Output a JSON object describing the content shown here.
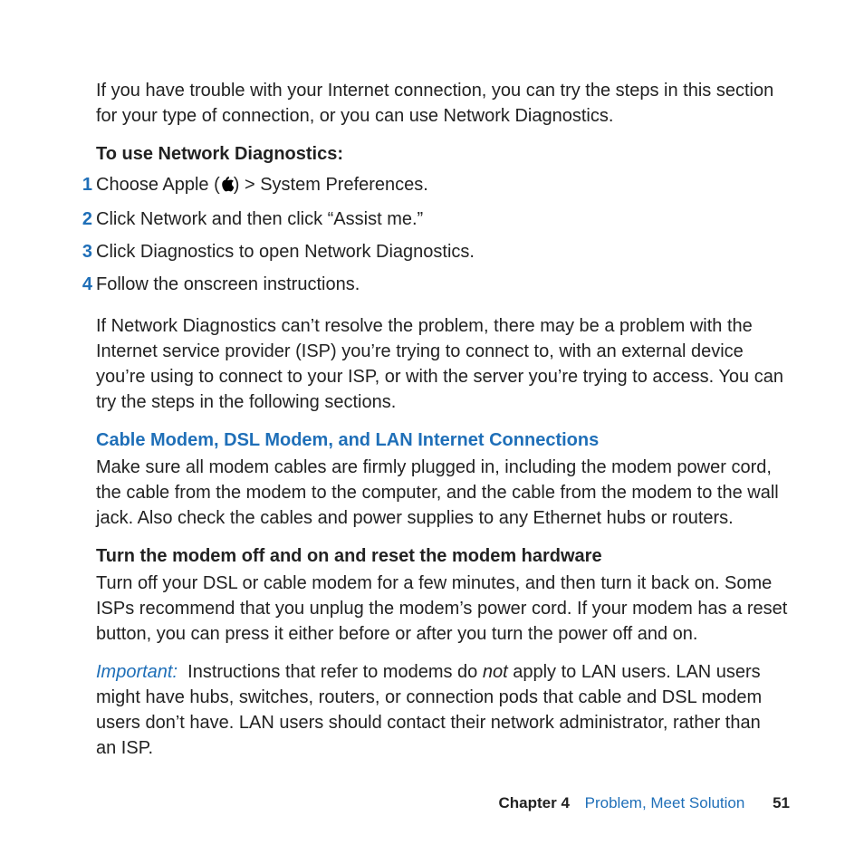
{
  "intro": "If you have trouble with your Internet connection, you can try the steps in this section for your type of connection, or you can use Network Diagnostics.",
  "diag_heading": "To use Network Diagnostics:",
  "steps": {
    "n1": "1",
    "s1_pre": "Choose Apple (",
    "s1_post": ") > System Preferences.",
    "n2": "2",
    "s2": "Click Network and then click “Assist me.”",
    "n3": "3",
    "s3": "Click Diagnostics to open Network Diagnostics.",
    "n4": "4",
    "s4": "Follow the onscreen instructions."
  },
  "diag_followup": "If Network Diagnostics can’t resolve the problem, there may be a problem with the Internet service provider (ISP) you’re trying to connect to, with an external device you’re using to connect to your ISP, or with the server you’re trying to access. You can try the steps in the following sections.",
  "cable_heading": "Cable Modem, DSL Modem, and LAN Internet Connections",
  "cable_body": "Make sure all modem cables are firmly plugged in, including the modem power cord, the cable from the modem to the computer, and the cable from the modem to the wall jack. Also check the cables and power supplies to any Ethernet hubs or routers.",
  "reset_heading": "Turn the modem off and on and reset the modem hardware",
  "reset_body": "Turn off your DSL or cable modem for a few minutes, and then turn it back on. Some ISPs recommend that you unplug the modem’s power cord. If your modem has a reset button, you can press it either before or after you turn the power off and on.",
  "important": {
    "label": "Important:  ",
    "pre": "Instructions that refer to modems do ",
    "not": "not",
    "post": " apply to LAN users. LAN users might have hubs, switches, routers, or connection pods that cable and DSL modem users don’t have. LAN users should contact their network administrator, rather than an ISP."
  },
  "footer": {
    "chapter_label": "Chapter 4",
    "chapter_title": "Problem, Meet Solution",
    "page_number": "51"
  }
}
